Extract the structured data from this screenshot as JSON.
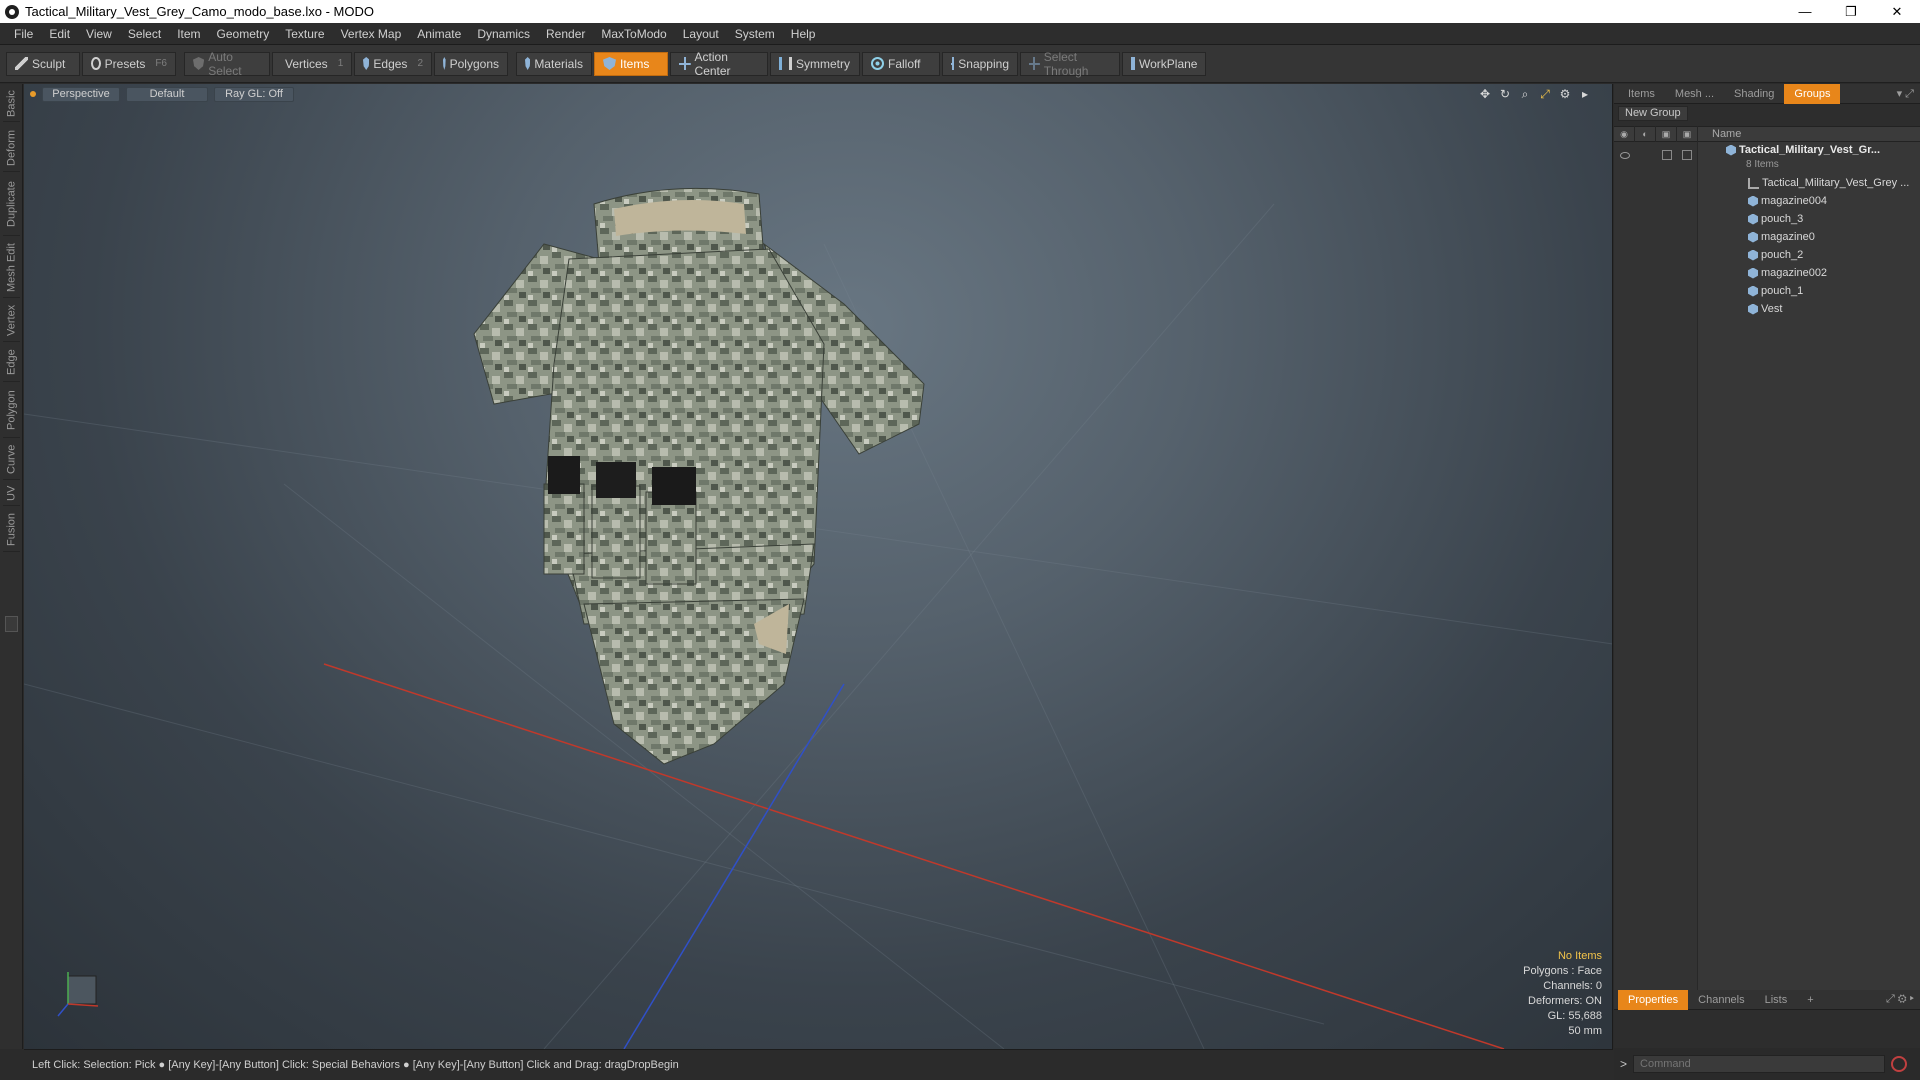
{
  "titlebar": {
    "title": "Tactical_Military_Vest_Grey_Camo_modo_base.lxo - MODO",
    "minimize": "—",
    "restore": "❐",
    "close": "✕"
  },
  "menu": [
    "File",
    "Edit",
    "View",
    "Select",
    "Item",
    "Geometry",
    "Texture",
    "Vertex Map",
    "Animate",
    "Dynamics",
    "Render",
    "MaxToModo",
    "Layout",
    "System",
    "Help"
  ],
  "toolbar": {
    "sculpt": "Sculpt",
    "presets": "Presets",
    "presets_key": "F6",
    "auto_select": "Auto Select",
    "vertices": "Vertices",
    "vertices_key": "1",
    "edges": "Edges",
    "edges_key": "2",
    "polygons": "Polygons",
    "materials": "Materials",
    "items": "Items",
    "action_center": "Action Center",
    "symmetry": "Symmetry",
    "falloff": "Falloff",
    "snapping": "Snapping",
    "select_through": "Select Through",
    "workplane": "WorkPlane"
  },
  "left_tabs": [
    "Basic",
    "Deform",
    "Duplicate",
    "Mesh Edit",
    "Vertex",
    "Edge",
    "Polygon",
    "Curve",
    "UV",
    "Fusion"
  ],
  "viewport": {
    "view": "Perspective",
    "shading": "Default",
    "raygl": "Ray GL: Off",
    "info": {
      "selection": "No Items",
      "polygons": "Polygons : Face",
      "channels": "Channels: 0",
      "deformers": "Deformers: ON",
      "gl": "GL: 55,688",
      "scale": "50 mm"
    }
  },
  "panel": {
    "tabs": [
      "Items",
      "Mesh ...",
      "Shading",
      "Groups"
    ],
    "active_tab": "Groups",
    "new_group": "New Group",
    "col_name": "Name",
    "root": {
      "name": "Tactical_Military_Vest_Gr...",
      "count": "8 Items"
    },
    "children": [
      {
        "name": "Tactical_Military_Vest_Grey ...",
        "icon": "locator-icon"
      },
      {
        "name": "magazine004",
        "icon": "mesh-icon"
      },
      {
        "name": "pouch_3",
        "icon": "mesh-icon"
      },
      {
        "name": "magazine0",
        "icon": "mesh-icon"
      },
      {
        "name": "pouch_2",
        "icon": "mesh-icon"
      },
      {
        "name": "magazine002",
        "icon": "mesh-icon"
      },
      {
        "name": "pouch_1",
        "icon": "mesh-icon"
      },
      {
        "name": "Vest",
        "icon": "mesh-icon"
      }
    ],
    "bottom_tabs": [
      "Properties",
      "Channels",
      "Lists",
      "+"
    ],
    "command_prompt": ">",
    "command_placeholder": "Command"
  },
  "statusbar": {
    "text": "Left Click: Selection: Pick ● [Any Key]-[Any Button] Click: Special Behaviors ● [Any Key]-[Any Button] Click and Drag: dragDropBegin"
  },
  "colors": {
    "accent": "#e8861a",
    "warning_text": "#f2c34a",
    "axis_x": "#c0392b",
    "axis_z": "#3050c8"
  }
}
